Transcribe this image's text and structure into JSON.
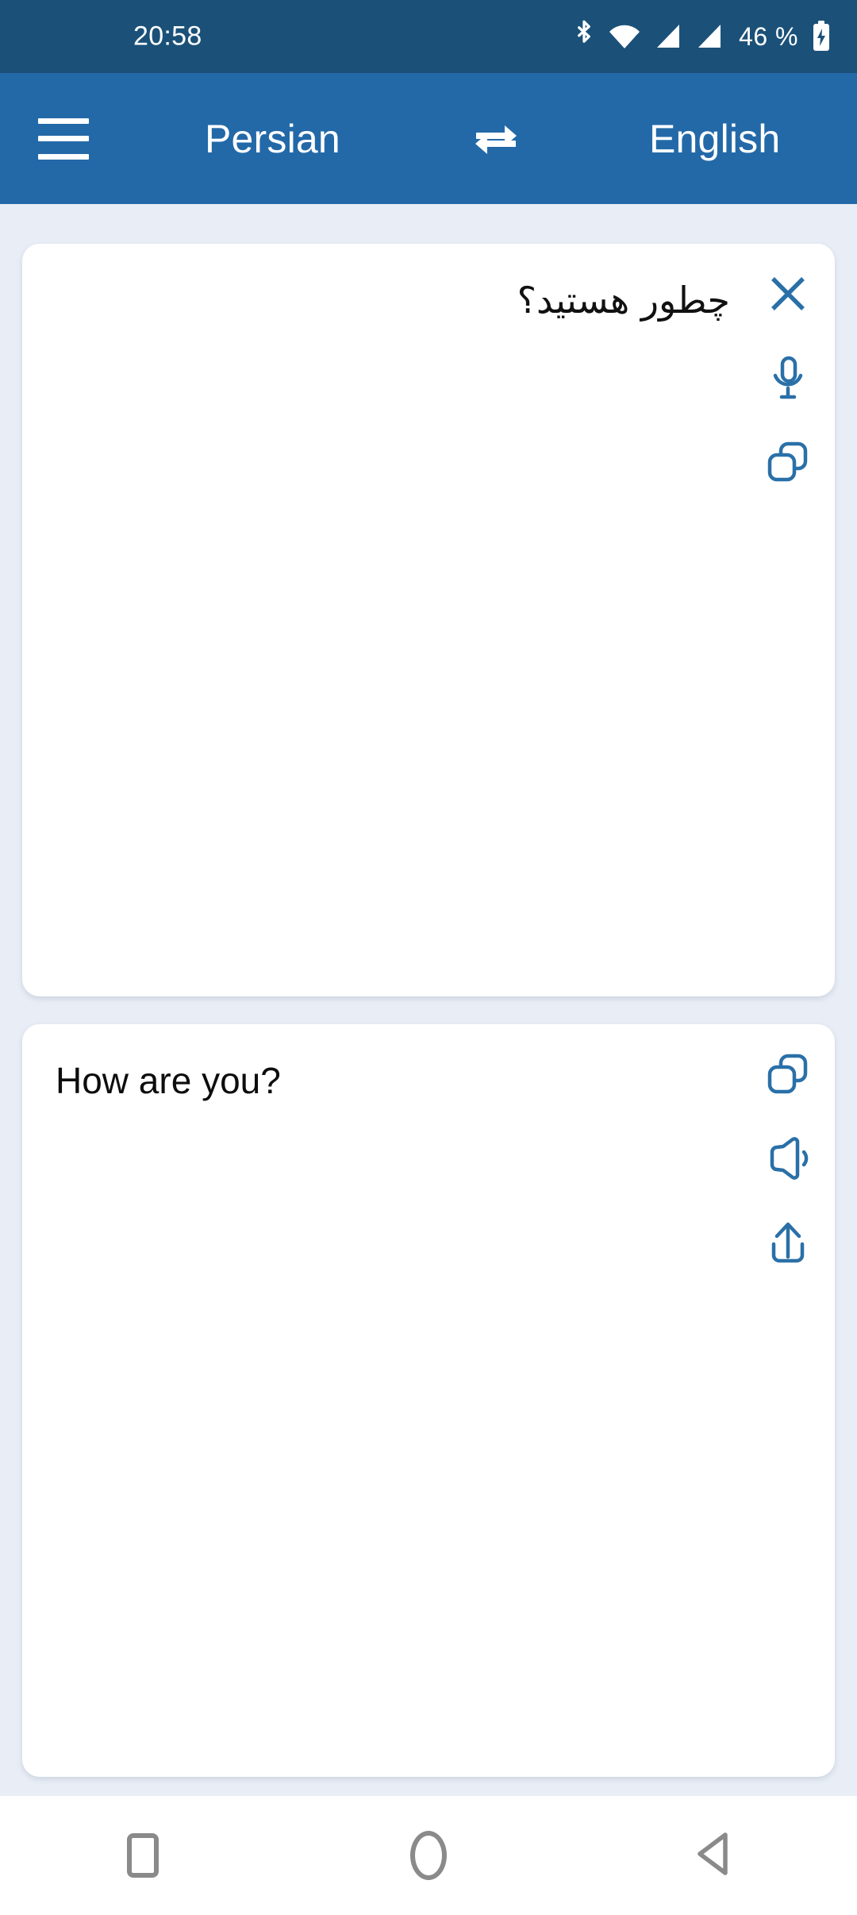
{
  "status_bar": {
    "clock": "20:58",
    "battery_percent": "46 %",
    "icons": [
      "bluetooth-icon",
      "wifi-icon",
      "signal-sim1-icon",
      "signal-sim2-icon",
      "battery-charging-icon"
    ],
    "background_color": "#1B5178",
    "foreground_color": "#FFFFFF"
  },
  "app_bar": {
    "menu_label": "menu",
    "source_language": "Persian",
    "target_language": "English",
    "swap_label": "swap languages",
    "background_color": "#2369A8",
    "foreground_color": "#FFFFFF"
  },
  "source_card": {
    "text": "چطور هستید؟",
    "actions": [
      {
        "name": "clear-button",
        "icon": "close-icon",
        "label": "Clear"
      },
      {
        "name": "speech-input-button",
        "icon": "microphone-icon",
        "label": "Speak"
      },
      {
        "name": "copy-source-button",
        "icon": "copy-icon",
        "label": "Copy"
      }
    ]
  },
  "target_card": {
    "text": "How are you?",
    "actions": [
      {
        "name": "copy-target-button",
        "icon": "copy-icon",
        "label": "Copy"
      },
      {
        "name": "speak-target-button",
        "icon": "speaker-icon",
        "label": "Listen"
      },
      {
        "name": "share-target-button",
        "icon": "share-icon",
        "label": "Share"
      }
    ]
  },
  "theme": {
    "page_background": "#E8EDF6",
    "card_background": "#FFFFFF",
    "icon_accent": "#2A70A8",
    "text_primary": "#111111"
  },
  "nav_bar": {
    "recents_label": "Recents",
    "home_label": "Home",
    "back_label": "Back",
    "background_color": "#FFFFFF",
    "icon_color": "#8A8A8A"
  }
}
